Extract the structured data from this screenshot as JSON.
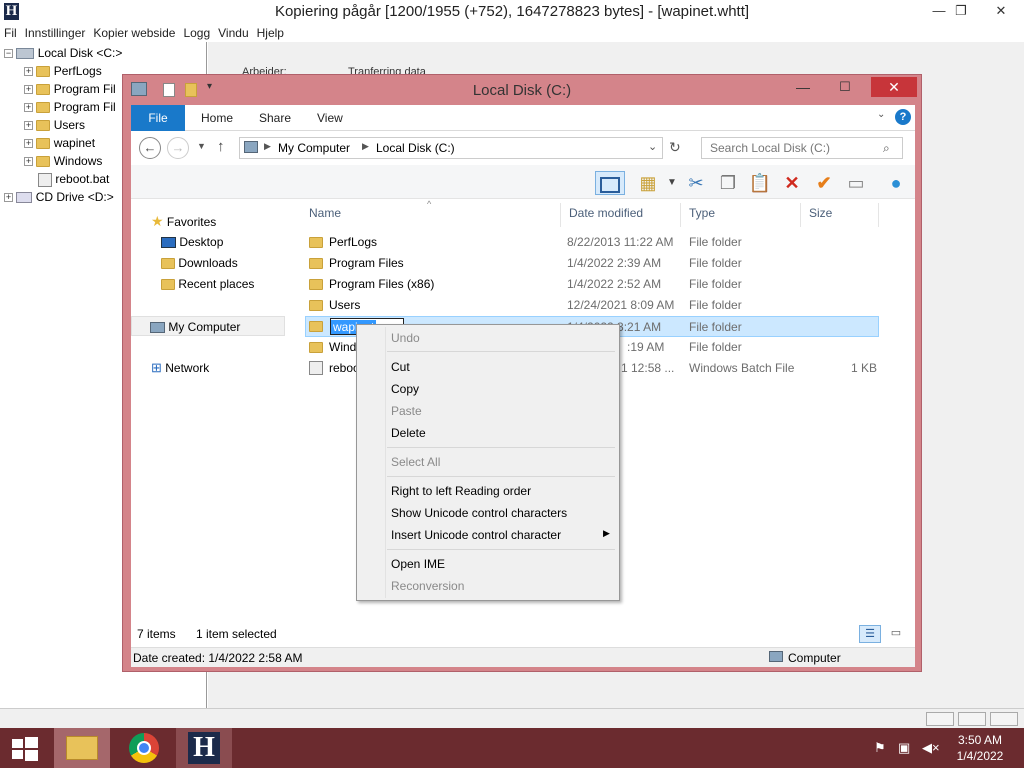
{
  "httrack": {
    "title": "Kopiering pågår [1200/1955 (+752), 1647278823 bytes] - [wapinet.whtt]",
    "logo": "H",
    "menu": [
      "Fil",
      "Innstillinger",
      "Kopier webside",
      "Logg",
      "Vindu",
      "Hjelp"
    ],
    "tree": [
      {
        "label": "Local Disk <C:>",
        "expander": "−"
      },
      {
        "label": "PerfLogs",
        "expander": "+"
      },
      {
        "label": "Program Fil",
        "expander": "+"
      },
      {
        "label": "Program Fil",
        "expander": "+"
      },
      {
        "label": "Users",
        "expander": "+"
      },
      {
        "label": "wapinet",
        "expander": "+"
      },
      {
        "label": "Windows",
        "expander": "+"
      },
      {
        "label": "reboot.bat",
        "expander": ""
      },
      {
        "label": "CD Drive <D:>",
        "expander": "+"
      }
    ],
    "right_labels": {
      "left": "Arbeider:",
      "right": "Tranferring data"
    }
  },
  "explorer": {
    "title": "Local Disk (C:)",
    "tabs": {
      "file": "File",
      "home": "Home",
      "share": "Share",
      "view": "View"
    },
    "breadcrumb": {
      "part1": "My Computer",
      "part2": "Local Disk (C:)"
    },
    "search_placeholder": "Search Local Disk (C:)",
    "nav": {
      "favorites": "Favorites",
      "desktop": "Desktop",
      "downloads": "Downloads",
      "recent": "Recent places",
      "computer": "My Computer",
      "network": "Network"
    },
    "columns": {
      "name": "Name",
      "date": "Date modified",
      "type": "Type",
      "size": "Size"
    },
    "files": [
      {
        "name": "PerfLogs",
        "date": "8/22/2013 11:22 AM",
        "type": "File folder",
        "size": ""
      },
      {
        "name": "Program Files",
        "date": "1/4/2022 2:39 AM",
        "type": "File folder",
        "size": ""
      },
      {
        "name": "Program Files (x86)",
        "date": "1/4/2022 2:52 AM",
        "type": "File folder",
        "size": ""
      },
      {
        "name": "Users",
        "date": "12/24/2021 8:09 AM",
        "type": "File folder",
        "size": ""
      },
      {
        "name": "wapinet",
        "date": "1/4/2022 3:21 AM",
        "type": "File folder",
        "size": ""
      },
      {
        "name": "Wind",
        "date": ":19 AM",
        "type": "File folder",
        "size": ""
      },
      {
        "name": "reboo",
        "date": "1 12:58 ...",
        "type": "Windows Batch File",
        "size": "1 KB"
      }
    ],
    "rename_value": "wapinet",
    "status": {
      "items": "7 items",
      "selected": "1 item selected"
    },
    "details": {
      "created": "Date created: 1/4/2022 2:58 AM",
      "location": "Computer"
    }
  },
  "context_menu": {
    "items": [
      {
        "label": "Undo",
        "disabled": true
      },
      {
        "label": "Cut",
        "disabled": false
      },
      {
        "label": "Copy",
        "disabled": false
      },
      {
        "label": "Paste",
        "disabled": true
      },
      {
        "label": "Delete",
        "disabled": false
      },
      {
        "label": "Select All",
        "disabled": true
      },
      {
        "label": "Right to left Reading order",
        "disabled": false
      },
      {
        "label": "Show Unicode control characters",
        "disabled": false
      },
      {
        "label": "Insert Unicode control character",
        "disabled": false
      },
      {
        "label": "Open IME",
        "disabled": false
      },
      {
        "label": "Reconversion",
        "disabled": true
      }
    ]
  },
  "taskbar": {
    "time": "3:50 AM",
    "date": "1/4/2022"
  },
  "colors": {
    "taskbar": "#6b2b2f",
    "explorer_frame": "#d4848a",
    "accent": "#1979ca"
  }
}
